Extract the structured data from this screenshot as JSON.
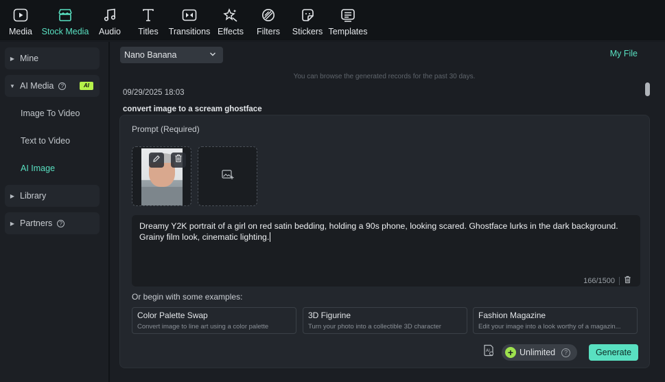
{
  "toolbar": {
    "items": [
      {
        "label": "Media",
        "icon": "media-icon"
      },
      {
        "label": "Stock Media",
        "icon": "stock-media-icon"
      },
      {
        "label": "Audio",
        "icon": "music-note-icon"
      },
      {
        "label": "Titles",
        "icon": "text-t-icon"
      },
      {
        "label": "Transitions",
        "icon": "transition-icon"
      },
      {
        "label": "Effects",
        "icon": "effects-sparkle-icon"
      },
      {
        "label": "Filters",
        "icon": "filter-icon"
      },
      {
        "label": "Stickers",
        "icon": "sticker-icon"
      },
      {
        "label": "Templates",
        "icon": "template-icon"
      }
    ],
    "active": "Stock Media"
  },
  "sidebar": {
    "mine": "Mine",
    "ai_media": "AI Media",
    "ai_badge": "AI",
    "sub_items": [
      "Image To Video",
      "Text to Video",
      "AI Image"
    ],
    "active_sub": "AI Image",
    "library": "Library",
    "partners": "Partners"
  },
  "main": {
    "model_select": "Nano Banana",
    "my_file": "My File",
    "notice": "You can browse the generated records for the past 30 days.",
    "record_date": "09/29/2025 18:03",
    "record_title": "convert image to a scream ghostface",
    "prompt_label": "Prompt (Required)",
    "prompt_text": "Dreamy Y2K portrait of a girl on red satin bedding, holding a 90s phone, looking scared. Ghostface lurks in the dark background. Grainy film look, cinematic lighting.",
    "char_count": "166/1500",
    "examples_label": "Or begin with some examples:",
    "examples": [
      {
        "title": "Color Palette Swap",
        "desc": "Convert image to line art using a color palette"
      },
      {
        "title": "3D Figurine",
        "desc": "Turn your photo into a collectible 3D character"
      },
      {
        "title": "Fashion Magazine",
        "desc": "Edit your image into a look worthy of a magazin..."
      }
    ],
    "credits_label": "Unlimited",
    "generate_label": "Generate"
  },
  "colors": {
    "accent": "#59e0c1",
    "ai_badge": "#b5f24a",
    "background": "#1b1e23"
  }
}
